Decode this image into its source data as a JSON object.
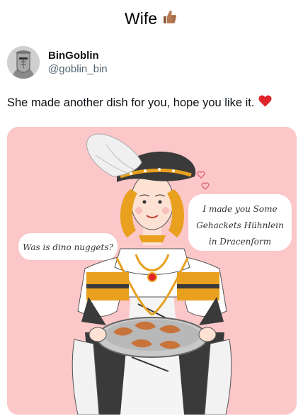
{
  "meme": {
    "title": "Wife",
    "emoji_icon": "thumbs-up-icon"
  },
  "post": {
    "author": {
      "display_name": "BinGoblin",
      "handle": "@goblin_bin",
      "avatar_icon": "knight-avatar-icon"
    },
    "text": "She made another dish for you, hope you like it.",
    "text_emoji_icon": "red-heart-icon"
  },
  "illustration": {
    "left_bubble": "Was is dino nuggets?",
    "right_bubble_lines": [
      "I made you Some",
      "Gehackets Hühnlein",
      "in Dracenform"
    ],
    "colors": {
      "background": "#fbc7c8",
      "gold": "#e8a01e",
      "dark": "#3a3a3a",
      "heart": "#e0242b"
    }
  }
}
